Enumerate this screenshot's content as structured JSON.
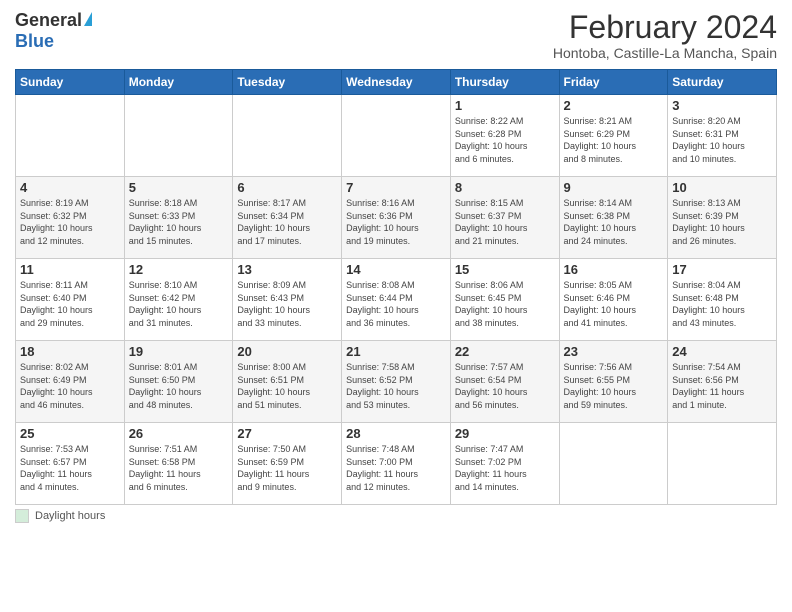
{
  "header": {
    "logo_general": "General",
    "logo_blue": "Blue",
    "title": "February 2024",
    "subtitle": "Hontoba, Castille-La Mancha, Spain",
    "legend_label": "Daylight hours"
  },
  "days_of_week": [
    "Sunday",
    "Monday",
    "Tuesday",
    "Wednesday",
    "Thursday",
    "Friday",
    "Saturday"
  ],
  "weeks": [
    [
      {
        "num": "",
        "info": ""
      },
      {
        "num": "",
        "info": ""
      },
      {
        "num": "",
        "info": ""
      },
      {
        "num": "",
        "info": ""
      },
      {
        "num": "1",
        "info": "Sunrise: 8:22 AM\nSunset: 6:28 PM\nDaylight: 10 hours\nand 6 minutes."
      },
      {
        "num": "2",
        "info": "Sunrise: 8:21 AM\nSunset: 6:29 PM\nDaylight: 10 hours\nand 8 minutes."
      },
      {
        "num": "3",
        "info": "Sunrise: 8:20 AM\nSunset: 6:31 PM\nDaylight: 10 hours\nand 10 minutes."
      }
    ],
    [
      {
        "num": "4",
        "info": "Sunrise: 8:19 AM\nSunset: 6:32 PM\nDaylight: 10 hours\nand 12 minutes."
      },
      {
        "num": "5",
        "info": "Sunrise: 8:18 AM\nSunset: 6:33 PM\nDaylight: 10 hours\nand 15 minutes."
      },
      {
        "num": "6",
        "info": "Sunrise: 8:17 AM\nSunset: 6:34 PM\nDaylight: 10 hours\nand 17 minutes."
      },
      {
        "num": "7",
        "info": "Sunrise: 8:16 AM\nSunset: 6:36 PM\nDaylight: 10 hours\nand 19 minutes."
      },
      {
        "num": "8",
        "info": "Sunrise: 8:15 AM\nSunset: 6:37 PM\nDaylight: 10 hours\nand 21 minutes."
      },
      {
        "num": "9",
        "info": "Sunrise: 8:14 AM\nSunset: 6:38 PM\nDaylight: 10 hours\nand 24 minutes."
      },
      {
        "num": "10",
        "info": "Sunrise: 8:13 AM\nSunset: 6:39 PM\nDaylight: 10 hours\nand 26 minutes."
      }
    ],
    [
      {
        "num": "11",
        "info": "Sunrise: 8:11 AM\nSunset: 6:40 PM\nDaylight: 10 hours\nand 29 minutes."
      },
      {
        "num": "12",
        "info": "Sunrise: 8:10 AM\nSunset: 6:42 PM\nDaylight: 10 hours\nand 31 minutes."
      },
      {
        "num": "13",
        "info": "Sunrise: 8:09 AM\nSunset: 6:43 PM\nDaylight: 10 hours\nand 33 minutes."
      },
      {
        "num": "14",
        "info": "Sunrise: 8:08 AM\nSunset: 6:44 PM\nDaylight: 10 hours\nand 36 minutes."
      },
      {
        "num": "15",
        "info": "Sunrise: 8:06 AM\nSunset: 6:45 PM\nDaylight: 10 hours\nand 38 minutes."
      },
      {
        "num": "16",
        "info": "Sunrise: 8:05 AM\nSunset: 6:46 PM\nDaylight: 10 hours\nand 41 minutes."
      },
      {
        "num": "17",
        "info": "Sunrise: 8:04 AM\nSunset: 6:48 PM\nDaylight: 10 hours\nand 43 minutes."
      }
    ],
    [
      {
        "num": "18",
        "info": "Sunrise: 8:02 AM\nSunset: 6:49 PM\nDaylight: 10 hours\nand 46 minutes."
      },
      {
        "num": "19",
        "info": "Sunrise: 8:01 AM\nSunset: 6:50 PM\nDaylight: 10 hours\nand 48 minutes."
      },
      {
        "num": "20",
        "info": "Sunrise: 8:00 AM\nSunset: 6:51 PM\nDaylight: 10 hours\nand 51 minutes."
      },
      {
        "num": "21",
        "info": "Sunrise: 7:58 AM\nSunset: 6:52 PM\nDaylight: 10 hours\nand 53 minutes."
      },
      {
        "num": "22",
        "info": "Sunrise: 7:57 AM\nSunset: 6:54 PM\nDaylight: 10 hours\nand 56 minutes."
      },
      {
        "num": "23",
        "info": "Sunrise: 7:56 AM\nSunset: 6:55 PM\nDaylight: 10 hours\nand 59 minutes."
      },
      {
        "num": "24",
        "info": "Sunrise: 7:54 AM\nSunset: 6:56 PM\nDaylight: 11 hours\nand 1 minute."
      }
    ],
    [
      {
        "num": "25",
        "info": "Sunrise: 7:53 AM\nSunset: 6:57 PM\nDaylight: 11 hours\nand 4 minutes."
      },
      {
        "num": "26",
        "info": "Sunrise: 7:51 AM\nSunset: 6:58 PM\nDaylight: 11 hours\nand 6 minutes."
      },
      {
        "num": "27",
        "info": "Sunrise: 7:50 AM\nSunset: 6:59 PM\nDaylight: 11 hours\nand 9 minutes."
      },
      {
        "num": "28",
        "info": "Sunrise: 7:48 AM\nSunset: 7:00 PM\nDaylight: 11 hours\nand 12 minutes."
      },
      {
        "num": "29",
        "info": "Sunrise: 7:47 AM\nSunset: 7:02 PM\nDaylight: 11 hours\nand 14 minutes."
      },
      {
        "num": "",
        "info": ""
      },
      {
        "num": "",
        "info": ""
      }
    ]
  ]
}
